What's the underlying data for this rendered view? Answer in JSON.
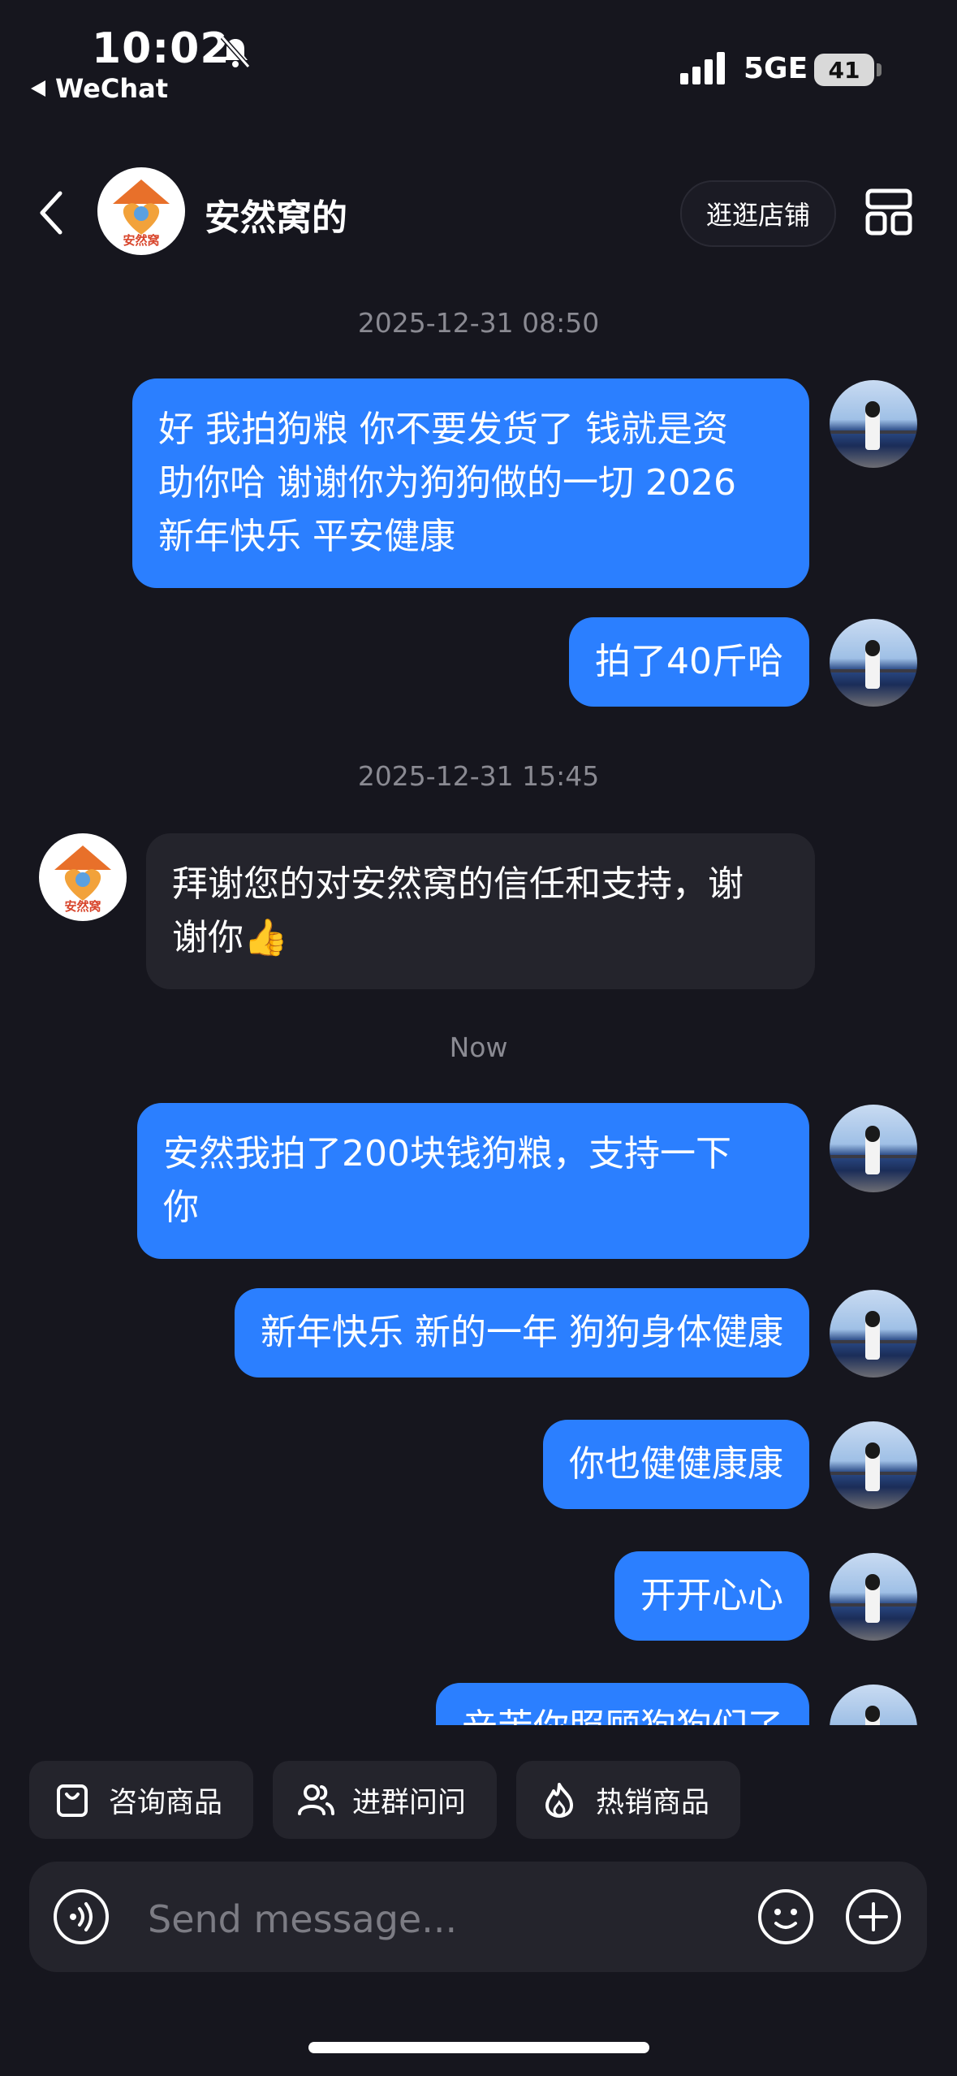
{
  "status": {
    "time": "10:02",
    "back_app": "WeChat",
    "network": "5GE",
    "battery": "41"
  },
  "header": {
    "title": "安然窝的",
    "visit_shop": "逛逛店铺",
    "logo_text": "安然窝"
  },
  "messages": [
    {
      "type": "timestamp",
      "text": "2025-12-31 08:50"
    },
    {
      "type": "out",
      "lines": [
        "好 我拍狗粮 你不要发货了 钱就是资",
        "助你哈 谢谢你为狗狗做的一切 2026",
        "新年快乐 平安健康"
      ]
    },
    {
      "type": "out",
      "lines": [
        "拍了40斤哈"
      ]
    },
    {
      "type": "timestamp",
      "text": "2025-12-31 15:45"
    },
    {
      "type": "in",
      "lines": [
        "拜谢您的对安然窝的信任和支持，谢",
        "谢你👍"
      ]
    },
    {
      "type": "timestamp",
      "text": "Now"
    },
    {
      "type": "out",
      "lines": [
        "安然我拍了200块钱狗粮，支持一下",
        "你"
      ]
    },
    {
      "type": "out",
      "lines": [
        "新年快乐 新的一年 狗狗身体健康"
      ]
    },
    {
      "type": "out",
      "lines": [
        "你也健健康康"
      ]
    },
    {
      "type": "out",
      "lines": [
        "开开心心"
      ]
    },
    {
      "type": "out",
      "lines": [
        "辛苦你照顾狗狗们了"
      ]
    }
  ],
  "quick_actions": [
    {
      "label": "咨询商品",
      "icon": "shopping-bag-icon"
    },
    {
      "label": "进群问问",
      "icon": "group-icon"
    },
    {
      "label": "热销商品",
      "icon": "flame-icon"
    }
  ],
  "composer": {
    "placeholder": "Send message..."
  },
  "colors": {
    "background": "#16161e",
    "outgoing_bubble": "#2b7fff",
    "incoming_bubble": "#24242c"
  }
}
